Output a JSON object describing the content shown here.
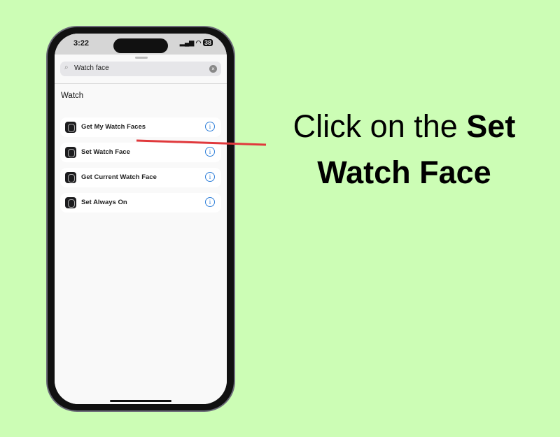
{
  "status": {
    "time": "3:22",
    "battery": "38"
  },
  "search": {
    "value": "Watch face"
  },
  "section_title": "Watch",
  "actions": [
    {
      "label": "Get My Watch Faces"
    },
    {
      "label": "Set Watch Face"
    },
    {
      "label": "Get Current Watch Face"
    },
    {
      "label": "Set Always On"
    }
  ],
  "caption": {
    "prefix": "Click on the ",
    "bold1": "Set",
    "bold2": "Watch Face"
  },
  "colors": {
    "background": "#ccfdb5",
    "pointer": "#e0393c",
    "info": "#2f7fd9"
  }
}
